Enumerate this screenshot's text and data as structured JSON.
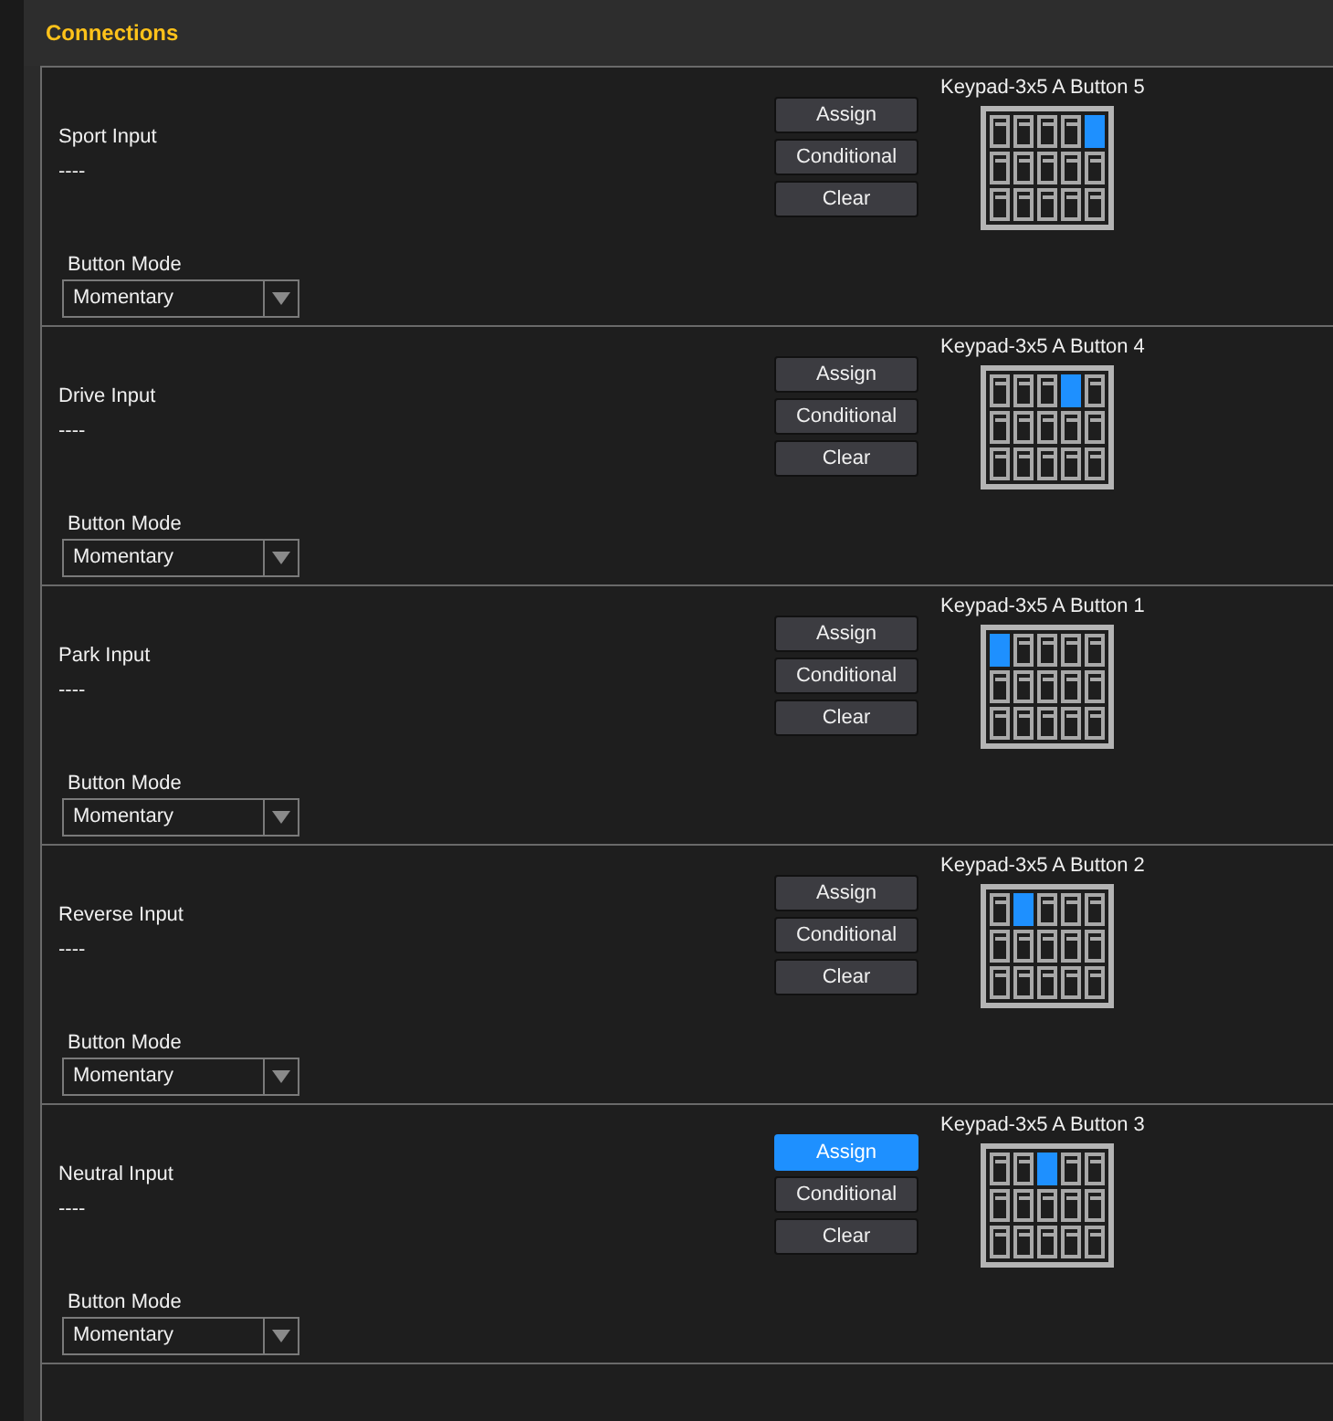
{
  "header": {
    "title": "Connections"
  },
  "connections": [
    {
      "name": "Sport Input",
      "value": "----",
      "buttons": [
        {
          "label": "Assign",
          "selected": false
        },
        {
          "label": "Conditional",
          "selected": false
        },
        {
          "label": "Clear",
          "selected": false
        }
      ],
      "keypad": {
        "title": "Keypad-3x5 A Button 5",
        "keys": [
          {
            "selected": false
          },
          {
            "selected": false
          },
          {
            "selected": false
          },
          {
            "selected": false
          },
          {
            "selected": true
          },
          {
            "selected": false
          },
          {
            "selected": false
          },
          {
            "selected": false
          },
          {
            "selected": false
          },
          {
            "selected": false
          },
          {
            "selected": false
          },
          {
            "selected": false
          },
          {
            "selected": false
          },
          {
            "selected": false
          },
          {
            "selected": false
          }
        ]
      },
      "mode_label": "Button Mode",
      "mode": "Momentary"
    },
    {
      "name": "Drive Input",
      "value": "----",
      "buttons": [
        {
          "label": "Assign",
          "selected": false
        },
        {
          "label": "Conditional",
          "selected": false
        },
        {
          "label": "Clear",
          "selected": false
        }
      ],
      "keypad": {
        "title": "Keypad-3x5 A Button 4",
        "keys": [
          {
            "selected": false
          },
          {
            "selected": false
          },
          {
            "selected": false
          },
          {
            "selected": true
          },
          {
            "selected": false
          },
          {
            "selected": false
          },
          {
            "selected": false
          },
          {
            "selected": false
          },
          {
            "selected": false
          },
          {
            "selected": false
          },
          {
            "selected": false
          },
          {
            "selected": false
          },
          {
            "selected": false
          },
          {
            "selected": false
          },
          {
            "selected": false
          }
        ]
      },
      "mode_label": "Button Mode",
      "mode": "Momentary"
    },
    {
      "name": "Park Input",
      "value": "----",
      "buttons": [
        {
          "label": "Assign",
          "selected": false
        },
        {
          "label": "Conditional",
          "selected": false
        },
        {
          "label": "Clear",
          "selected": false
        }
      ],
      "keypad": {
        "title": "Keypad-3x5 A Button 1",
        "keys": [
          {
            "selected": true
          },
          {
            "selected": false
          },
          {
            "selected": false
          },
          {
            "selected": false
          },
          {
            "selected": false
          },
          {
            "selected": false
          },
          {
            "selected": false
          },
          {
            "selected": false
          },
          {
            "selected": false
          },
          {
            "selected": false
          },
          {
            "selected": false
          },
          {
            "selected": false
          },
          {
            "selected": false
          },
          {
            "selected": false
          },
          {
            "selected": false
          }
        ]
      },
      "mode_label": "Button Mode",
      "mode": "Momentary"
    },
    {
      "name": "Reverse Input",
      "value": "----",
      "buttons": [
        {
          "label": "Assign",
          "selected": false
        },
        {
          "label": "Conditional",
          "selected": false
        },
        {
          "label": "Clear",
          "selected": false
        }
      ],
      "keypad": {
        "title": "Keypad-3x5 A Button 2",
        "keys": [
          {
            "selected": false
          },
          {
            "selected": true
          },
          {
            "selected": false
          },
          {
            "selected": false
          },
          {
            "selected": false
          },
          {
            "selected": false
          },
          {
            "selected": false
          },
          {
            "selected": false
          },
          {
            "selected": false
          },
          {
            "selected": false
          },
          {
            "selected": false
          },
          {
            "selected": false
          },
          {
            "selected": false
          },
          {
            "selected": false
          },
          {
            "selected": false
          }
        ]
      },
      "mode_label": "Button Mode",
      "mode": "Momentary"
    },
    {
      "name": "Neutral Input",
      "value": "----",
      "buttons": [
        {
          "label": "Assign",
          "selected": true
        },
        {
          "label": "Conditional",
          "selected": false
        },
        {
          "label": "Clear",
          "selected": false
        }
      ],
      "keypad": {
        "title": "Keypad-3x5 A Button 3",
        "keys": [
          {
            "selected": false
          },
          {
            "selected": false
          },
          {
            "selected": true
          },
          {
            "selected": false
          },
          {
            "selected": false
          },
          {
            "selected": false
          },
          {
            "selected": false
          },
          {
            "selected": false
          },
          {
            "selected": false
          },
          {
            "selected": false
          },
          {
            "selected": false
          },
          {
            "selected": false
          },
          {
            "selected": false
          },
          {
            "selected": false
          },
          {
            "selected": false
          }
        ]
      },
      "mode_label": "Button Mode",
      "mode": "Momentary"
    }
  ]
}
